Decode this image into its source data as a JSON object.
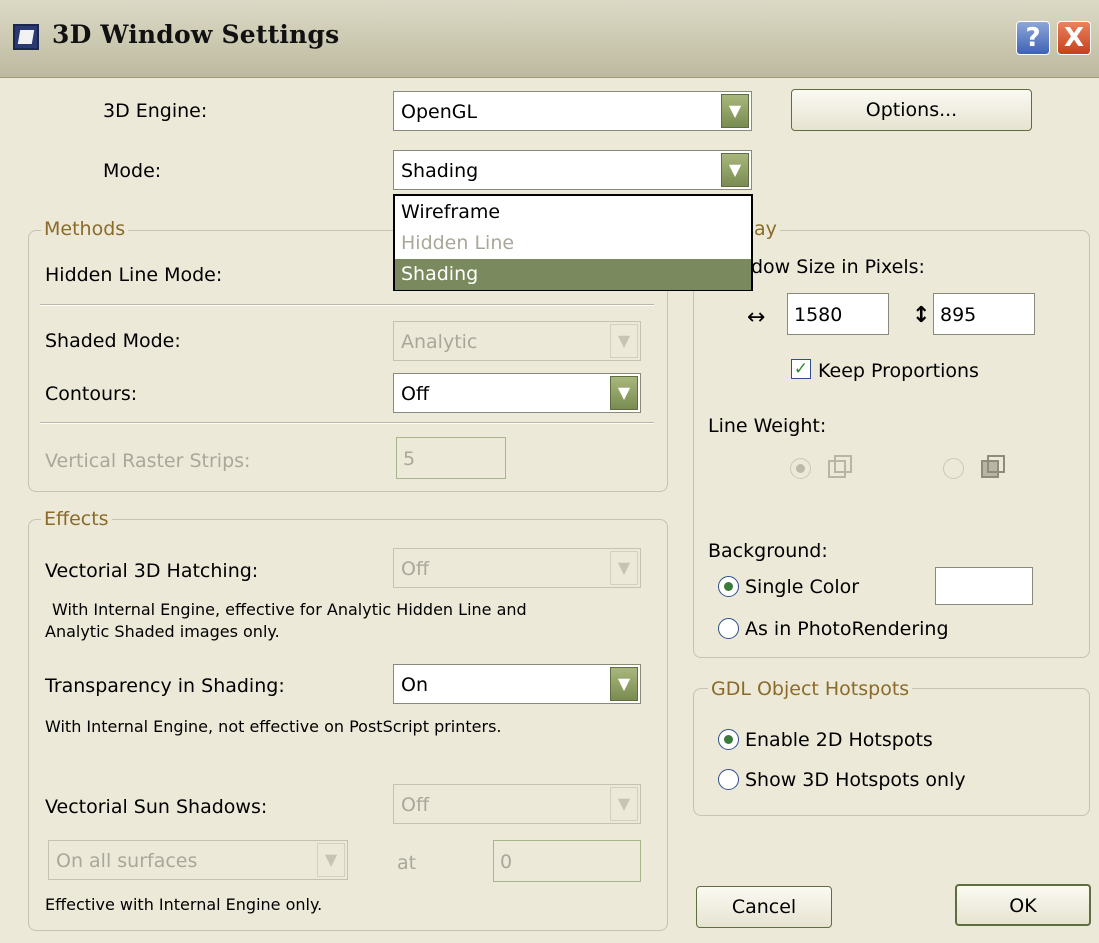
{
  "window": {
    "title": "3D Window Settings",
    "help": "?",
    "close": "X"
  },
  "engine": {
    "label": "3D Engine:",
    "value": "OpenGL",
    "options_button": "Options..."
  },
  "mode": {
    "label": "Mode:",
    "value": "Shading",
    "dropdown": [
      "Wireframe",
      "Hidden Line",
      "Shading"
    ]
  },
  "methods": {
    "legend": "Methods",
    "hidden_line_mode_label": "Hidden Line Mode:",
    "shaded_mode_label": "Shaded Mode:",
    "shaded_mode_value": "Analytic",
    "contours_label": "Contours:",
    "contours_value": "Off",
    "raster_label": "Vertical Raster Strips:",
    "raster_value": "5"
  },
  "effects": {
    "legend": "Effects",
    "hatching_label": "Vectorial 3D Hatching:",
    "hatching_value": "Off",
    "hatching_note_1": "With Internal Engine, effective for Analytic Hidden Line and",
    "hatching_note_2": "Analytic Shaded images only.",
    "transparency_label": "Transparency in Shading:",
    "transparency_value": "On",
    "transparency_note": "With Internal Engine, not effective on PostScript printers.",
    "sun_label": "Vectorial Sun Shadows:",
    "sun_value": "Off",
    "surfaces_value": "On all surfaces",
    "at_label": "at",
    "at_value": "0",
    "sun_note": "Effective with Internal Engine only."
  },
  "display": {
    "legend_partial": "ay",
    "size_label_partial": "dow Size in Pixels:",
    "width_symbol": "↔",
    "width": "1580",
    "height_symbol": "↕",
    "height": "895",
    "keep_proportions": "Keep Proportions",
    "line_weight_label": "Line Weight:",
    "background_label": "Background:",
    "single_color": "Single Color",
    "photorendering": "As in PhotoRendering"
  },
  "gdl": {
    "legend": "GDL Object Hotspots",
    "enable_2d": "Enable 2D Hotspots",
    "show_3d": "Show 3D Hotspots only"
  },
  "buttons": {
    "cancel": "Cancel",
    "ok": "OK"
  },
  "colors": {
    "accent_olive": "#7b8a5e",
    "legend_brown": "#8a6b2a",
    "dialog_bg": "#ece9d8"
  }
}
